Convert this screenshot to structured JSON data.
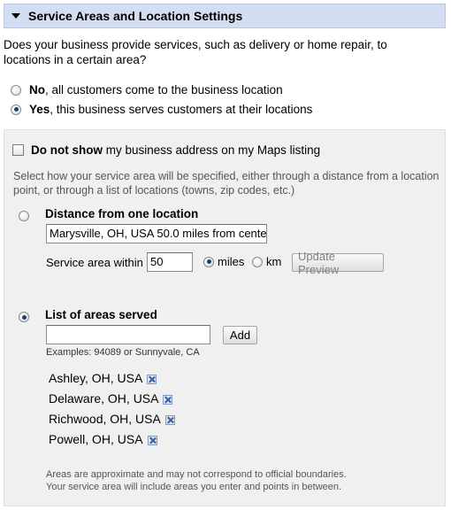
{
  "header": {
    "title": "Service Areas and Location Settings"
  },
  "question": "Does your business provide services, such as delivery or home repair, to locations in a certain area?",
  "service_options": [
    {
      "bold": "No",
      "rest": ", all customers come to the business location",
      "checked": false
    },
    {
      "bold": "Yes",
      "rest": ", this business serves customers at their locations",
      "checked": true
    }
  ],
  "hide_address": {
    "bold": "Do not show",
    "rest": " my business address on my Maps listing",
    "checked": false
  },
  "instructions": "Select how your service area will be specified, either through a distance from a location point, or through a list of locations (towns, zip codes, etc.)",
  "distance": {
    "label": "Distance from one location",
    "location_value": "Marysville, OH, USA 50.0 miles from cente",
    "within_label": "Service area within",
    "within_value": "50",
    "unit_miles": "miles",
    "unit_km": "km",
    "update_button": "Update Preview",
    "selected": false
  },
  "list": {
    "label": "List of areas served",
    "input_value": "",
    "add_button": "Add",
    "examples": "Examples: 94089 or Sunnyvale, CA",
    "selected": true,
    "areas": [
      "Ashley, OH, USA",
      "Delaware, OH, USA",
      "Richwood, OH, USA",
      "Powell, OH, USA"
    ]
  },
  "footnote": {
    "line1": "Areas are approximate and may not correspond to official boundaries.",
    "line2": "Your service area will include areas you enter and points in between."
  }
}
